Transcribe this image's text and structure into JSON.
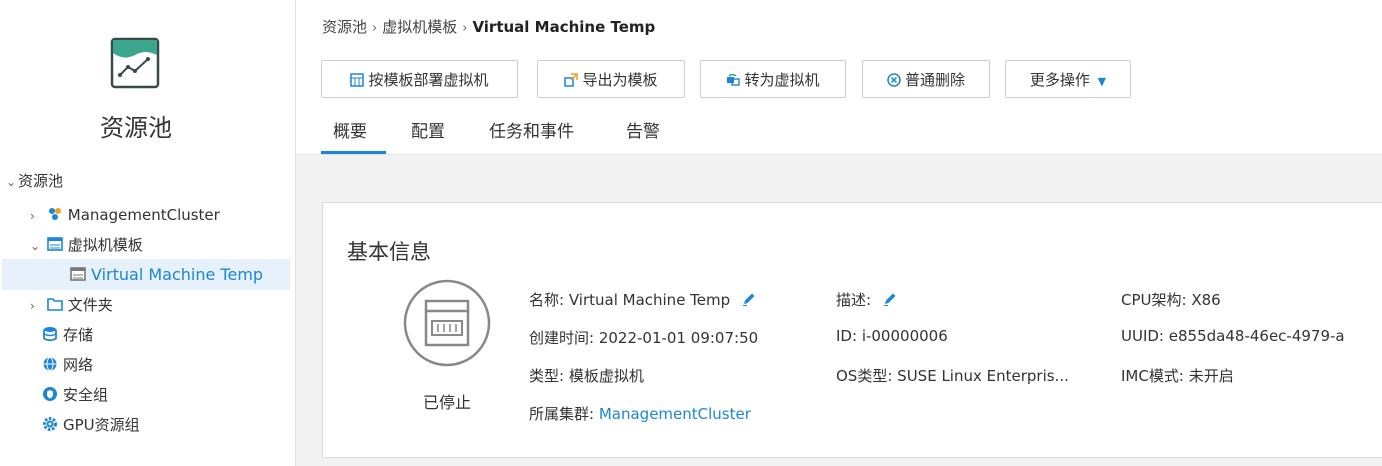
{
  "sidebar": {
    "title": "资源池",
    "tree": {
      "root": "资源池",
      "items": [
        {
          "label": "ManagementCluster",
          "icon": "cluster-icon"
        },
        {
          "label": "虚拟机模板",
          "icon": "template-folder-icon"
        },
        {
          "label": "Virtual Machine Temp",
          "icon": "vm-template-icon",
          "selected": true
        },
        {
          "label": "文件夹",
          "icon": "folder-icon"
        },
        {
          "label": "存储",
          "icon": "storage-icon"
        },
        {
          "label": "网络",
          "icon": "network-icon"
        },
        {
          "label": "安全组",
          "icon": "security-group-icon"
        },
        {
          "label": "GPU资源组",
          "icon": "gpu-icon"
        }
      ]
    }
  },
  "breadcrumb": {
    "items": [
      "资源池",
      "虚拟机模板"
    ],
    "current": "Virtual Machine Temp",
    "separator": "›"
  },
  "toolbar": {
    "deploy": "按模板部署虚拟机",
    "export": "导出为模板",
    "convert": "转为虚拟机",
    "delete": "普通删除",
    "more": "更多操作"
  },
  "tabs": [
    "概要",
    "配置",
    "任务和事件",
    "告警"
  ],
  "card": {
    "title": "基本信息",
    "status": "已停止",
    "fields": {
      "name": {
        "label": "名称:",
        "value": "Virtual Machine Temp"
      },
      "created": {
        "label": "创建时间:",
        "value": "2022-01-01 09:07:50"
      },
      "type": {
        "label": "类型:",
        "value": "模板虚拟机"
      },
      "cluster": {
        "label": "所属集群:",
        "value": "ManagementCluster"
      },
      "desc": {
        "label": "描述:",
        "value": ""
      },
      "id": {
        "label": "ID:",
        "value": "i-00000006"
      },
      "os": {
        "label": "OS类型:",
        "value": "SUSE Linux Enterpris..."
      },
      "cpu": {
        "label": "CPU架构:",
        "value": "X86"
      },
      "uuid": {
        "label": "UUID:",
        "value": "e855da48-46ec-4979-a"
      },
      "imc": {
        "label": "IMC模式:",
        "value": "未开启"
      }
    }
  },
  "colors": {
    "accent": "#1b86d6",
    "selected_bg": "#e6f1fb",
    "content_bg": "#f2f2f2"
  }
}
